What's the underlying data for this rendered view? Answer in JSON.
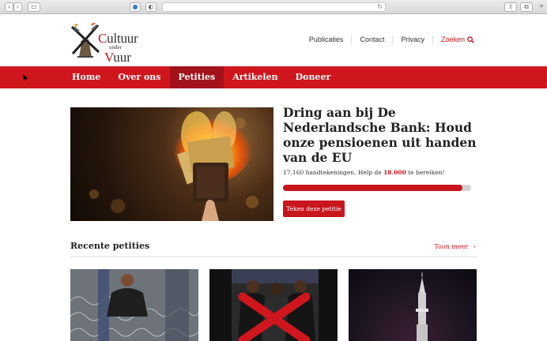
{
  "browser": {
    "back_icon": "chevron-left-icon",
    "forward_icon": "chevron-right-icon",
    "sidebar_icon": "sidebar-icon",
    "reload_icon": "reload-icon"
  },
  "header": {
    "logo": {
      "word1": "Cultuur",
      "word2": "onder",
      "word3": "Vuur"
    },
    "links": [
      "Publicaties",
      "Contact",
      "Privacy"
    ],
    "search_label": "Zoeken",
    "search_icon": "search-icon"
  },
  "menu": {
    "items": [
      {
        "label": "Home",
        "active": false
      },
      {
        "label": "Over ons",
        "active": false
      },
      {
        "label": "Petities",
        "active": true
      },
      {
        "label": "Artikelen",
        "active": false
      },
      {
        "label": "Doneer",
        "active": false
      }
    ]
  },
  "hero": {
    "title": "Dring aan bij De Nederlandsche Bank: Houd onze pensioenen uit handen van de EU",
    "count_prefix": "17.160 handtekeningen. Help de",
    "count_goal": "18.000",
    "count_suffix": "te bereiken!",
    "progress_fraction": 0.953,
    "button_label": "Teken deze petitie"
  },
  "recent": {
    "title": "Recente petities",
    "more_label": "Toon meer",
    "more_icon": "chevron-right-icon"
  },
  "colors": {
    "accent": "#c8161d",
    "menu_active": "#a3121a"
  }
}
